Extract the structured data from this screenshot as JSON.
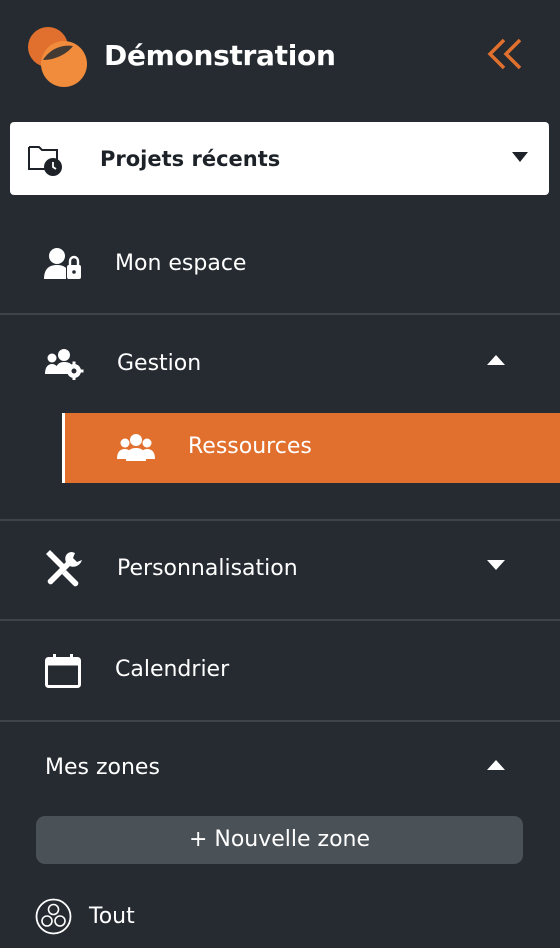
{
  "header": {
    "title": "Démonstration",
    "logo_icon": "app-logo",
    "collapse_icon": "double-chevron-left-icon",
    "accent_color": "#e1702e"
  },
  "recent_projects": {
    "label": "Projets récents",
    "icon": "folder-clock-icon",
    "caret": "caret-down-icon"
  },
  "nav": {
    "mon_espace": {
      "label": "Mon espace",
      "icon": "user-lock-icon"
    },
    "gestion": {
      "label": "Gestion",
      "icon": "users-gear-icon",
      "expanded": true,
      "children": [
        {
          "label": "Ressources",
          "icon": "users-group-icon",
          "active": true
        }
      ]
    },
    "personnalisation": {
      "label": "Personnalisation",
      "icon": "tools-icon",
      "expanded": false
    },
    "calendrier": {
      "label": "Calendrier",
      "icon": "calendar-icon"
    }
  },
  "zones": {
    "title": "Mes zones",
    "expanded": true,
    "new_zone_label": "+ Nouvelle zone",
    "items": [
      {
        "label": "Tout",
        "icon": "circles-icon"
      }
    ]
  },
  "colors": {
    "sidebar_bg": "#252b31",
    "active_bg": "#e1702e",
    "divider": "#3d444b",
    "button_bg": "#4a5157"
  }
}
